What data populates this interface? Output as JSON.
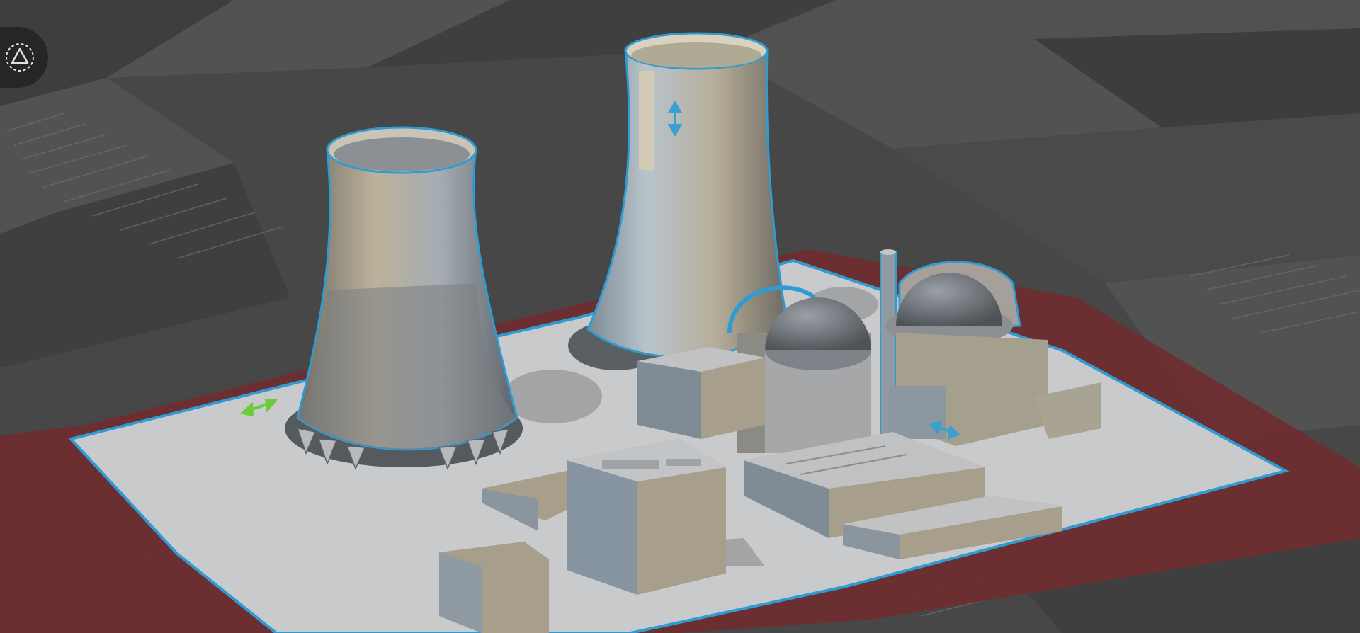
{
  "app": {
    "view": "3d-print-preview"
  },
  "toolbar": {
    "view_toggle_icon": "triangle-in-dashed-circle-icon"
  },
  "colors": {
    "grid_dark": "#3f3f3f",
    "grid_light": "#555555",
    "build_plate_zone": "#6e2e31",
    "model_base": "#c9cacb",
    "selection_outline": "#2f9bd3",
    "model_warm": "#b8ad97",
    "model_cool": "#8f9aa3",
    "gizmo_green": "#6ccb3a",
    "gizmo_blue": "#3aa0d0"
  },
  "model": {
    "name_icon": "nuclear-plant-model-icon",
    "selected": true
  }
}
